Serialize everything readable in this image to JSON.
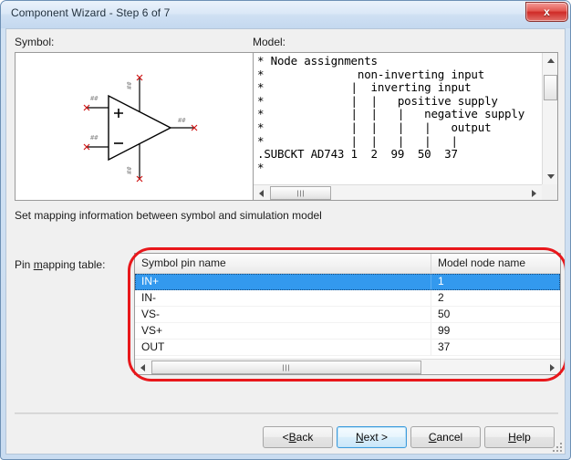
{
  "window": {
    "title": "Component Wizard - Step 6 of 7",
    "close_label": "x",
    "accent_selection": "#3399ee",
    "annotation_color": "#e8171b",
    "titlebar_color": "#dbe8f7",
    "dialog_bg": "#f0f0f0"
  },
  "symbol": {
    "label": "Symbol:",
    "icon": "opamp-symbol",
    "pin_marks": [
      "##",
      "##",
      "##",
      "##",
      "##"
    ],
    "plus_label": "+",
    "minus_label": "−"
  },
  "model": {
    "label": "Model:",
    "text": "* Node assignments\n*              non-inverting input\n*             |  inverting input\n*             |  |   positive supply\n*             |  |   |   negative supply\n*             |  |   |   |   output\n*             |  |   |   |   |\n.SUBCKT AD743 1  2  99  50  37\n*",
    "vscroll": {
      "up": "▲",
      "down": "▼"
    },
    "hscroll": {
      "left": "◀",
      "right": "▶"
    }
  },
  "instructions": {
    "mapping_info": "Set mapping information between symbol and simulation model",
    "pin_table_label_pre": "Pin ",
    "pin_table_label_mnemonic": "m",
    "pin_table_label_post": "apping table:"
  },
  "pin_table": {
    "columns": [
      "Symbol pin name",
      "Model node name"
    ],
    "rows": [
      {
        "symbol_pin": "IN+",
        "model_node": "1",
        "selected": true
      },
      {
        "symbol_pin": "IN-",
        "model_node": "2",
        "selected": false
      },
      {
        "symbol_pin": "VS-",
        "model_node": "50",
        "selected": false
      },
      {
        "symbol_pin": "VS+",
        "model_node": "99",
        "selected": false
      },
      {
        "symbol_pin": "OUT",
        "model_node": "37",
        "selected": false
      }
    ],
    "hscroll": {
      "left": "◀",
      "right": "▶"
    }
  },
  "buttons": {
    "back": {
      "pre": "< ",
      "mnemonic": "B",
      "post": "ack",
      "default": false
    },
    "next": {
      "pre": "",
      "mnemonic": "N",
      "post": "ext >",
      "default": true
    },
    "cancel": {
      "pre": "",
      "mnemonic": "C",
      "post": "ancel",
      "default": false
    },
    "help": {
      "pre": "",
      "mnemonic": "H",
      "post": "elp",
      "default": false
    }
  }
}
